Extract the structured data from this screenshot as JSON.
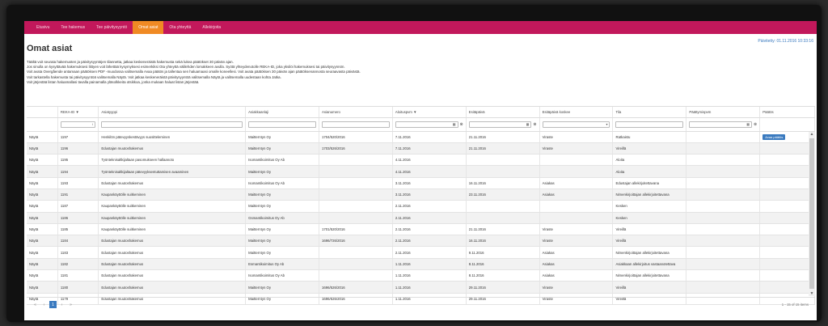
{
  "nav": {
    "items": [
      "Etusivu",
      "Tee hakemus",
      "Tee päivitysyyntö",
      "Omat asiat",
      "Ota yhteyttä",
      "Allekirjoita"
    ],
    "active_index": 3
  },
  "header": {
    "title": "Omat asiat",
    "updated": "Päivitetty: 01.11.2016 10:33:16"
  },
  "intro": [
    "Täältä voit seurata hakemusten ja päivitysyyntöjen tilannetta, jatkaa keskeneräistä hakemusta sekä lukea päätökset 30 päivän ajan.",
    "Jos sinulla on kysyttävää hakemuksesi liittyen voit lähettää kysymyksesi esimerkiksi Ota yhteyttä välilehden lomakkeen avulla. Syötä yhteydenotolle REKA-ID, joka yksilöi hakemuksesi tai päivitysyynnön.",
    "Voit avata Overgående antamaan päätöksen PDF -muodossa valitsemalla Avaa päätös ja tallentaa sen haluamaasi omalle koneellesi. Voit avata päätöksen 30 päivän ajan päätöksenannosta seuraavasta päivästä.",
    "Voit tarkastella hakemusta tai päivitysyyntöä valitsemalla Näytä. Voit jatkaa keskeneräistä päivitysyyntöä valitsemalla Näytä ja valitsemalla uudestaan kohta Jatka.",
    "Voit järjestää listan haluamallasi tavalla painamalla yläsolkkeita otsikkoa, jonka mukaan haluat listan järjestää."
  ],
  "table": {
    "columns": [
      "",
      "REKA-ID ▼",
      "Asiatyyppi",
      "Asiakkaanlaji",
      "Asianumero",
      "Aloituspvm ▼",
      "Esitäpäivä",
      "Esitäpäivä koskee",
      "Tila",
      "Päättymispvm",
      "Päätös"
    ],
    "filter_placeholders": {
      "reka_id": "",
      "asiatyyppi": "",
      "asiakas": "",
      "asianumero": ""
    },
    "rows": [
      [
        "Näytä",
        "1197",
        "Henkilön pätevyyskestävyys suositteleminen",
        "Maitterntyn Oy",
        "1704/520/2016",
        "7.11.2016",
        "21.11.2016",
        "Viraste",
        "Ratkaistu",
        "",
        "Avaa päätös"
      ],
      [
        "Näytä",
        "1196",
        "Edustajan muutoshakemus",
        "Maitterntyn Oy",
        "1703/526/2016",
        "7.11.2016",
        "21.11.2016",
        "Viraste",
        "Vireillä",
        "",
        ""
      ],
      [
        "Näytä",
        "1195",
        "Työnteknisaltkijaltaan pasomukseen hallaanoto",
        "Isomantikoimitus Oy Ab",
        "",
        "4.11.2016",
        "",
        "",
        "Aloita",
        "",
        ""
      ],
      [
        "Näytä",
        "1194",
        "Työnteknisaltkijaltaan pätevyyksentuttamisen avaaminen",
        "Maitterntyn Oy",
        "",
        "4.11.2016",
        "",
        "",
        "Aloita",
        "",
        ""
      ],
      [
        "Näytä",
        "1193",
        "Edustajan muutoshakemus",
        "Isomantikoimitus Oy Ab",
        "",
        "3.11.2016",
        "16.11.2016",
        "Asiakas",
        "Edustajan allekirjoitettavana",
        "",
        ""
      ],
      [
        "Näytä",
        "1191",
        "Kaupankäyttölle suitkeminen",
        "Maitterntyn Oy",
        "",
        "3.11.2016",
        "23.11.2016",
        "Asiakas",
        "Nimenkirjoittajan allekirjoitettavana",
        "",
        ""
      ],
      [
        "Näytä",
        "1187",
        "Kaupankäyttölle suitkeminen",
        "Maitterntyn Oy",
        "",
        "2.11.2016",
        "",
        "",
        "Kesken",
        "",
        ""
      ],
      [
        "Näytä",
        "1186",
        "Kaupankäyttölle suitkeminen",
        "Gsmantikoimitus Oy Ab",
        "",
        "2.11.2016",
        "",
        "",
        "Kesken",
        "",
        ""
      ],
      [
        "Näytä",
        "1185",
        "Kaupankäyttölle suitkeminen",
        "Maitterntyn Oy",
        "1701/520/2016",
        "2.11.2016",
        "21.11.2016",
        "Viraste",
        "Vireillä",
        "",
        ""
      ],
      [
        "Näytä",
        "1184",
        "Edustajan muutoshakemus",
        "Maitterntyn Oy",
        "1696/726/2016",
        "2.11.2016",
        "16.11.2016",
        "Viraste",
        "Vireillä",
        "",
        ""
      ],
      [
        "Näytä",
        "1183",
        "Edustajan muutoshakemus",
        "Maitterntyn Oy",
        "",
        "2.11.2016",
        "9.11.2016",
        "Asiakas",
        "Nimenkirjoittajan allekirjoitettavana",
        "",
        ""
      ],
      [
        "Näytä",
        "1182",
        "Edustajan muutoshakemus",
        "Esmantikoimitus Oy Ab",
        "",
        "1.11.2016",
        "8.11.2016",
        "Asiakas",
        "Asiakkaan allekirjoitus vastaanotettava",
        "",
        ""
      ],
      [
        "Näytä",
        "1181",
        "Edustajan muutoshakemus",
        "Isomantikoimitus Oy Ab",
        "",
        "1.11.2016",
        "8.11.2016",
        "Asiakas",
        "Nimenkirjoittajan allekirjoitettavana",
        "",
        ""
      ],
      [
        "Näytä",
        "1180",
        "Edustajan muutoshakemus",
        "Maitterntyn Oy",
        "1696/526/2016",
        "1.11.2016",
        "29.11.2016",
        "Viraste",
        "Vireillä",
        "",
        ""
      ],
      [
        "Näytä",
        "1179",
        "Edustajan muutoshakemus",
        "Maitterntyn Oy",
        "1696/526/2016",
        "1.11.2016",
        "29.11.2016",
        "Viraste",
        "Vireillä",
        "",
        ""
      ]
    ]
  },
  "pager": {
    "first": "«",
    "prev": "‹",
    "current": "1",
    "next": "›",
    "last": "»",
    "info": "1 - 15 of 15 items"
  },
  "colors": {
    "nav_bg": "#c2185b",
    "nav_active": "#f08a24",
    "accent": "#3a7abf"
  }
}
